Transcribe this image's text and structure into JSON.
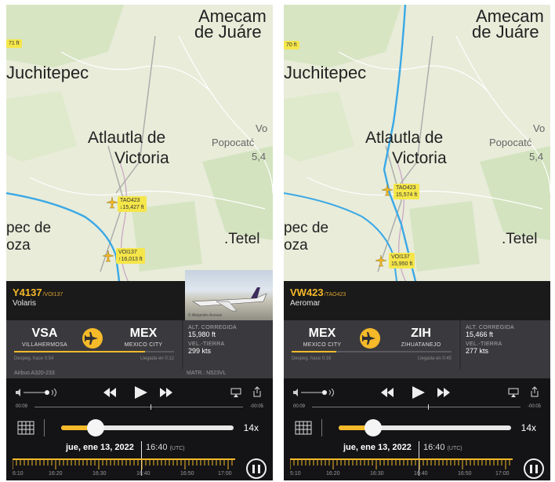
{
  "colors": {
    "accent": "#f5b929",
    "plane_tag": "#f5e64a",
    "route_line": "#3aa8e6",
    "panel_bg": "#2f2f33"
  },
  "left": {
    "map_labels": {
      "amecameca": "Amecam",
      "juarez": "de Juáre",
      "juchitepec": "Juchitepec",
      "atlautla": "Atlautla de",
      "victoria": "Victoria",
      "vol": "Vo",
      "popocatepetl": "Popocatć",
      "elev": "5,4",
      "pec": "pec de",
      "oza": "oza",
      "tetela": ".Tetel",
      "edge_tag": "71 ft"
    },
    "planes": [
      {
        "id": "TAO423",
        "alt": "↓15,427 ft",
        "icon": "airplane-icon"
      },
      {
        "id": "VOI137",
        "alt": "↑16,013 ft",
        "icon": "airplane-icon"
      }
    ],
    "flight": {
      "callsign": "Y4137",
      "callsign_sub": "/VOI137",
      "airline": "Volaris",
      "photo_credit": "© Alejandro Acevez",
      "from_code": "VSA",
      "from_city": "VILLAHERMOSA",
      "to_code": "MEX",
      "to_city": "MEXICO CITY",
      "departed": "Despeg. hace 0:54",
      "arrival": "Llegada en 0:12",
      "progress": 0.82,
      "alt_label": "ALT. CORREGIDA",
      "alt_value": "15,980 ft",
      "speed_label": "VEL.-TIERRA",
      "speed_value": "299 kts",
      "aircraft": "Airbus A320-233",
      "reg": "MATR.: N523VL"
    },
    "playback": {
      "elapsed": "00:09",
      "remaining": "-00:05",
      "speed": "14x",
      "speed_fraction": 0.2,
      "date": "jue, ene 13, 2022",
      "time": "16:40",
      "tz": "(UTC)",
      "ticks": [
        "6:10",
        "16:20",
        "16:30",
        "16:40",
        "16:50",
        "17:00"
      ]
    }
  },
  "right": {
    "map_labels": {
      "amecameca": "Amecam",
      "juarez": "de Juáre",
      "juchitepec": "Juchitepec",
      "atlautla": "Atlautla de",
      "victoria": "Victoria",
      "vol": "Vo",
      "popocatepetl": "Popocatć",
      "elev": "5,4",
      "pec": "pec de",
      "oza": "oza",
      "tetela": ".Tetel",
      "edge_tag": "70 ft"
    },
    "planes": [
      {
        "id": "TAO423",
        "alt": "15,574 ft",
        "icon": "airplane-icon"
      },
      {
        "id": "VOI137",
        "alt": "15,950 ft",
        "icon": "airplane-icon"
      }
    ],
    "flight": {
      "callsign": "VW423",
      "callsign_sub": "/TAO423",
      "airline": "Aeromar",
      "from_code": "MEX",
      "from_city": "MEXICO CITY",
      "to_code": "ZIH",
      "to_city": "ZIHUATANEJO",
      "departed": "Despeg. hace 0:16",
      "arrival": "Llegada en 0:45",
      "progress": 0.28,
      "alt_label": "ALT. CORREGIDA",
      "alt_value": "15,466 ft",
      "speed_label": "VEL.-TIERRA",
      "speed_value": "277 kts"
    },
    "playback": {
      "elapsed": "00:09",
      "remaining": "-00:05",
      "speed": "14x",
      "speed_fraction": 0.2,
      "date": "jue, ene 13, 2022",
      "time": "16:40",
      "tz": "(UTC)",
      "ticks": [
        "5:10",
        "16:20",
        "16:30",
        "16:40",
        "16:50",
        "17:00"
      ]
    }
  }
}
